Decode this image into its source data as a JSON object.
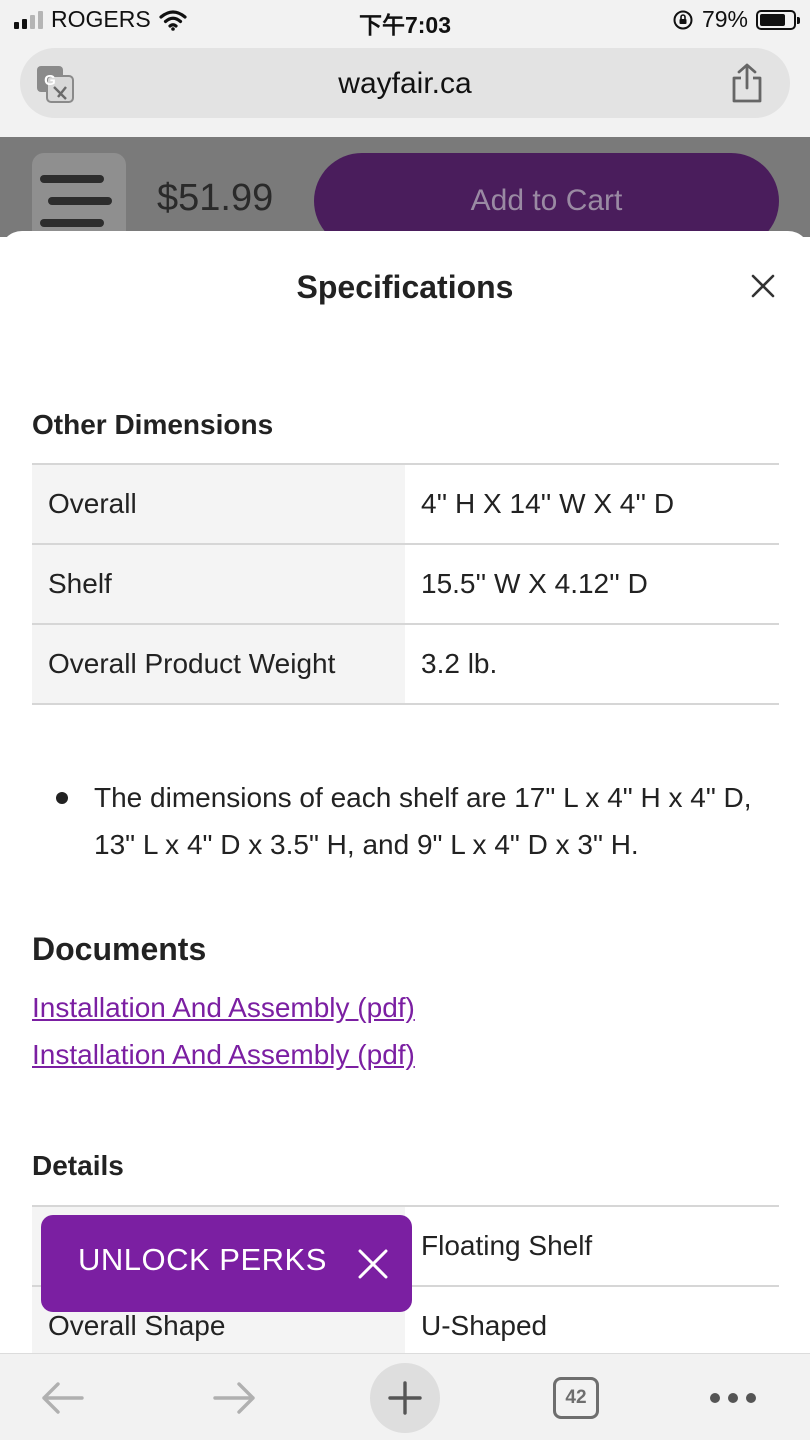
{
  "status_bar": {
    "carrier": "ROGERS",
    "time": "下午7:03",
    "battery": "79%",
    "battery_level": 0.79
  },
  "browser": {
    "url": "wayfair.ca",
    "tab_count": "42"
  },
  "page_behind": {
    "price": "$51.99",
    "add_to_cart": "Add to Cart"
  },
  "sheet": {
    "title": "Specifications",
    "other_dimensions": {
      "heading": "Other Dimensions",
      "rows": [
        {
          "label": "Overall",
          "value": "4'' H X 14'' W X 4'' D"
        },
        {
          "label": "Shelf",
          "value": "15.5'' W X 4.12'' D"
        },
        {
          "label": "Overall Product Weight",
          "value": "3.2 lb."
        }
      ]
    },
    "note": "The dimensions of each shelf are 17\" L x 4\" H x 4\" D, 13\" L x 4\" D x 3.5\" H, and 9\" L x 4\" D x 3\" H.",
    "documents": {
      "heading": "Documents",
      "links": [
        "Installation And Assembly (pdf)",
        "Installation And Assembly (pdf)"
      ]
    },
    "details": {
      "heading": "Details",
      "rows": [
        {
          "label": "",
          "value": "Floating Shelf"
        },
        {
          "label": "Overall Shape",
          "value": "U-Shaped"
        }
      ]
    }
  },
  "promo": {
    "label": "UNLOCK PERKS"
  },
  "colors": {
    "brand_purple": "#7b1fa2",
    "cart_purple": "#4a1d5c"
  }
}
